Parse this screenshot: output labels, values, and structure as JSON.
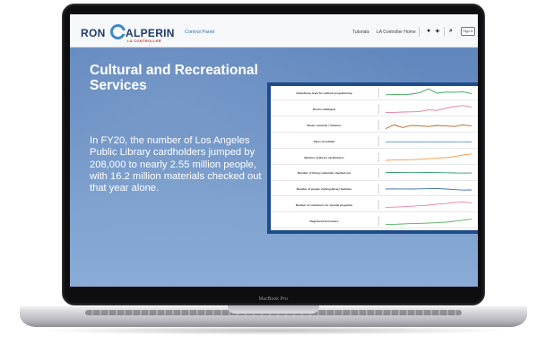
{
  "device": {
    "label": "MacBook Pro"
  },
  "header": {
    "logo": {
      "first": "RON",
      "last_initial": "G",
      "last_rest": "ALPERIN",
      "subtitle": "LA CONTROLLER"
    },
    "section": "Control Panel",
    "nav": [
      {
        "label": "Tutorials"
      },
      {
        "label": "LA Controller Home"
      }
    ],
    "icons": [
      "github-icon",
      "twitter-icon",
      "search-icon"
    ],
    "signin_label": "Sign In"
  },
  "hero": {
    "title": "Cultural and Recreational Services",
    "body": "In FY20, the number of Los Angeles Public Library cardholders jumped by 208,000 to nearly 2.55 million people, with 16.2 million materials checked out that year alone."
  },
  "metrics": [
    {
      "label": "Attendance level for cultural programming",
      "color": "#38a35a",
      "values": [
        0.35,
        0.37,
        0.36,
        0.42,
        0.55,
        0.9,
        0.5,
        0.6,
        0.58,
        0.62,
        0.45
      ]
    },
    {
      "label": "Books cataloged",
      "color": "#e97aa6",
      "values": [
        0.2,
        0.22,
        0.25,
        0.27,
        0.3,
        0.45,
        0.4,
        0.6,
        0.75,
        0.85,
        0.7
      ]
    },
    {
      "label": "Books received / Volumes",
      "color": "#b5651d",
      "values": [
        0.2,
        0.55,
        0.3,
        0.5,
        0.45,
        0.4,
        0.5,
        0.45,
        0.4,
        0.55,
        0.45
      ]
    },
    {
      "label": "Items circulated",
      "color": "#6a9cd6",
      "values": [
        0.45,
        0.46,
        0.45,
        0.47,
        0.46,
        0.47,
        0.46,
        0.47,
        0.46,
        0.47,
        0.46
      ]
    },
    {
      "label": "Number of library cardholders",
      "color": "#f29b4b",
      "values": [
        0.25,
        0.28,
        0.3,
        0.32,
        0.35,
        0.4,
        0.45,
        0.5,
        0.6,
        0.75,
        0.85
      ]
    },
    {
      "label": "Number of library materials checked out",
      "color": "#2e9d6a",
      "values": [
        0.55,
        0.54,
        0.55,
        0.56,
        0.55,
        0.54,
        0.53,
        0.52,
        0.5,
        0.48,
        0.5
      ]
    },
    {
      "label": "Number of people visiting library facilities",
      "color": "#3f6fb8",
      "values": [
        0.5,
        0.52,
        0.51,
        0.5,
        0.52,
        0.53,
        0.55,
        0.5,
        0.45,
        0.4,
        0.42
      ]
    },
    {
      "label": "Number of volunteers for special programs",
      "color": "#f07fa8",
      "values": [
        0.3,
        0.32,
        0.35,
        0.4,
        0.45,
        0.5,
        0.6,
        0.65,
        0.75,
        0.8,
        0.7
      ]
    },
    {
      "label": "Registered borrowers",
      "color": "#57b560",
      "values": [
        0.2,
        0.22,
        0.25,
        0.28,
        0.3,
        0.33,
        0.37,
        0.42,
        0.5,
        0.6,
        0.7
      ]
    }
  ]
}
